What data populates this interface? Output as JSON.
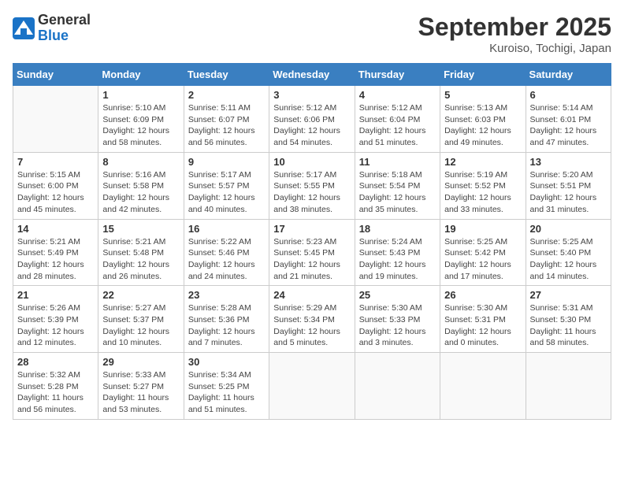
{
  "header": {
    "logo_general": "General",
    "logo_blue": "Blue",
    "title": "September 2025",
    "location": "Kuroiso, Tochigi, Japan"
  },
  "days_of_week": [
    "Sunday",
    "Monday",
    "Tuesday",
    "Wednesday",
    "Thursday",
    "Friday",
    "Saturday"
  ],
  "weeks": [
    [
      {
        "day": "",
        "sunrise": "",
        "sunset": "",
        "daylight": ""
      },
      {
        "day": "1",
        "sunrise": "Sunrise: 5:10 AM",
        "sunset": "Sunset: 6:09 PM",
        "daylight": "Daylight: 12 hours and 58 minutes."
      },
      {
        "day": "2",
        "sunrise": "Sunrise: 5:11 AM",
        "sunset": "Sunset: 6:07 PM",
        "daylight": "Daylight: 12 hours and 56 minutes."
      },
      {
        "day": "3",
        "sunrise": "Sunrise: 5:12 AM",
        "sunset": "Sunset: 6:06 PM",
        "daylight": "Daylight: 12 hours and 54 minutes."
      },
      {
        "day": "4",
        "sunrise": "Sunrise: 5:12 AM",
        "sunset": "Sunset: 6:04 PM",
        "daylight": "Daylight: 12 hours and 51 minutes."
      },
      {
        "day": "5",
        "sunrise": "Sunrise: 5:13 AM",
        "sunset": "Sunset: 6:03 PM",
        "daylight": "Daylight: 12 hours and 49 minutes."
      },
      {
        "day": "6",
        "sunrise": "Sunrise: 5:14 AM",
        "sunset": "Sunset: 6:01 PM",
        "daylight": "Daylight: 12 hours and 47 minutes."
      }
    ],
    [
      {
        "day": "7",
        "sunrise": "Sunrise: 5:15 AM",
        "sunset": "Sunset: 6:00 PM",
        "daylight": "Daylight: 12 hours and 45 minutes."
      },
      {
        "day": "8",
        "sunrise": "Sunrise: 5:16 AM",
        "sunset": "Sunset: 5:58 PM",
        "daylight": "Daylight: 12 hours and 42 minutes."
      },
      {
        "day": "9",
        "sunrise": "Sunrise: 5:17 AM",
        "sunset": "Sunset: 5:57 PM",
        "daylight": "Daylight: 12 hours and 40 minutes."
      },
      {
        "day": "10",
        "sunrise": "Sunrise: 5:17 AM",
        "sunset": "Sunset: 5:55 PM",
        "daylight": "Daylight: 12 hours and 38 minutes."
      },
      {
        "day": "11",
        "sunrise": "Sunrise: 5:18 AM",
        "sunset": "Sunset: 5:54 PM",
        "daylight": "Daylight: 12 hours and 35 minutes."
      },
      {
        "day": "12",
        "sunrise": "Sunrise: 5:19 AM",
        "sunset": "Sunset: 5:52 PM",
        "daylight": "Daylight: 12 hours and 33 minutes."
      },
      {
        "day": "13",
        "sunrise": "Sunrise: 5:20 AM",
        "sunset": "Sunset: 5:51 PM",
        "daylight": "Daylight: 12 hours and 31 minutes."
      }
    ],
    [
      {
        "day": "14",
        "sunrise": "Sunrise: 5:21 AM",
        "sunset": "Sunset: 5:49 PM",
        "daylight": "Daylight: 12 hours and 28 minutes."
      },
      {
        "day": "15",
        "sunrise": "Sunrise: 5:21 AM",
        "sunset": "Sunset: 5:48 PM",
        "daylight": "Daylight: 12 hours and 26 minutes."
      },
      {
        "day": "16",
        "sunrise": "Sunrise: 5:22 AM",
        "sunset": "Sunset: 5:46 PM",
        "daylight": "Daylight: 12 hours and 24 minutes."
      },
      {
        "day": "17",
        "sunrise": "Sunrise: 5:23 AM",
        "sunset": "Sunset: 5:45 PM",
        "daylight": "Daylight: 12 hours and 21 minutes."
      },
      {
        "day": "18",
        "sunrise": "Sunrise: 5:24 AM",
        "sunset": "Sunset: 5:43 PM",
        "daylight": "Daylight: 12 hours and 19 minutes."
      },
      {
        "day": "19",
        "sunrise": "Sunrise: 5:25 AM",
        "sunset": "Sunset: 5:42 PM",
        "daylight": "Daylight: 12 hours and 17 minutes."
      },
      {
        "day": "20",
        "sunrise": "Sunrise: 5:25 AM",
        "sunset": "Sunset: 5:40 PM",
        "daylight": "Daylight: 12 hours and 14 minutes."
      }
    ],
    [
      {
        "day": "21",
        "sunrise": "Sunrise: 5:26 AM",
        "sunset": "Sunset: 5:39 PM",
        "daylight": "Daylight: 12 hours and 12 minutes."
      },
      {
        "day": "22",
        "sunrise": "Sunrise: 5:27 AM",
        "sunset": "Sunset: 5:37 PM",
        "daylight": "Daylight: 12 hours and 10 minutes."
      },
      {
        "day": "23",
        "sunrise": "Sunrise: 5:28 AM",
        "sunset": "Sunset: 5:36 PM",
        "daylight": "Daylight: 12 hours and 7 minutes."
      },
      {
        "day": "24",
        "sunrise": "Sunrise: 5:29 AM",
        "sunset": "Sunset: 5:34 PM",
        "daylight": "Daylight: 12 hours and 5 minutes."
      },
      {
        "day": "25",
        "sunrise": "Sunrise: 5:30 AM",
        "sunset": "Sunset: 5:33 PM",
        "daylight": "Daylight: 12 hours and 3 minutes."
      },
      {
        "day": "26",
        "sunrise": "Sunrise: 5:30 AM",
        "sunset": "Sunset: 5:31 PM",
        "daylight": "Daylight: 12 hours and 0 minutes."
      },
      {
        "day": "27",
        "sunrise": "Sunrise: 5:31 AM",
        "sunset": "Sunset: 5:30 PM",
        "daylight": "Daylight: 11 hours and 58 minutes."
      }
    ],
    [
      {
        "day": "28",
        "sunrise": "Sunrise: 5:32 AM",
        "sunset": "Sunset: 5:28 PM",
        "daylight": "Daylight: 11 hours and 56 minutes."
      },
      {
        "day": "29",
        "sunrise": "Sunrise: 5:33 AM",
        "sunset": "Sunset: 5:27 PM",
        "daylight": "Daylight: 11 hours and 53 minutes."
      },
      {
        "day": "30",
        "sunrise": "Sunrise: 5:34 AM",
        "sunset": "Sunset: 5:25 PM",
        "daylight": "Daylight: 11 hours and 51 minutes."
      },
      {
        "day": "",
        "sunrise": "",
        "sunset": "",
        "daylight": ""
      },
      {
        "day": "",
        "sunrise": "",
        "sunset": "",
        "daylight": ""
      },
      {
        "day": "",
        "sunrise": "",
        "sunset": "",
        "daylight": ""
      },
      {
        "day": "",
        "sunrise": "",
        "sunset": "",
        "daylight": ""
      }
    ]
  ]
}
